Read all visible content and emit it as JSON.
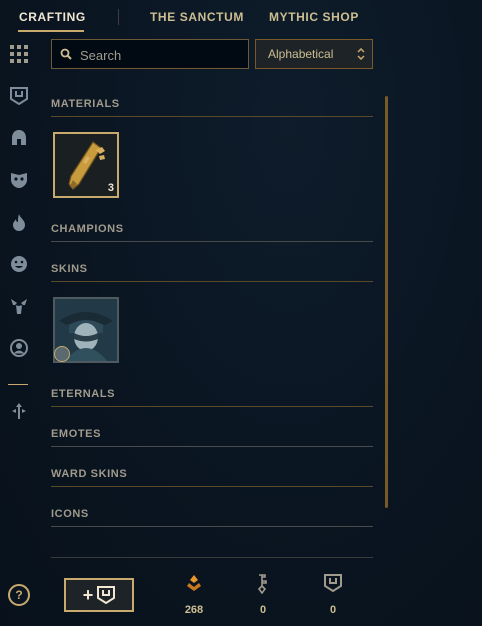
{
  "nav": {
    "tabs": [
      {
        "label": "CRAFTING"
      },
      {
        "label": "THE SANCTUM"
      },
      {
        "label": "MYTHIC SHOP"
      }
    ]
  },
  "sidebar": {
    "items": [
      {
        "icon": "grid-icon"
      },
      {
        "icon": "chest-icon"
      },
      {
        "icon": "helmet-icon"
      },
      {
        "icon": "mask-icon"
      },
      {
        "icon": "flame-icon"
      },
      {
        "icon": "emote-icon"
      },
      {
        "icon": "ward-icon"
      },
      {
        "icon": "profile-icon"
      },
      {
        "icon": "arrows-icon"
      }
    ]
  },
  "search": {
    "placeholder": "Search"
  },
  "sort": {
    "label": "Alphabetical"
  },
  "sections": {
    "materials": "MATERIALS",
    "champions": "CHAMPIONS",
    "skins": "SKINS",
    "eternals": "ETERNALS",
    "emotes": "EMOTES",
    "ward_skins": "WARD SKINS",
    "icons": "ICONS"
  },
  "materials": [
    {
      "icon": "key-fragment-icon",
      "count": "3"
    }
  ],
  "skins": [
    {
      "icon": "skin-shard-icon"
    }
  ],
  "footer": {
    "help": "?",
    "add_button": "+",
    "currencies": [
      {
        "icon": "orange-essence-icon",
        "value": "268"
      },
      {
        "icon": "key-icon",
        "value": "0"
      },
      {
        "icon": "chest-icon",
        "value": "0"
      }
    ]
  },
  "colors": {
    "accent": "#c8aa6e",
    "text": "#cdbe91",
    "bg": "#0a1521"
  }
}
